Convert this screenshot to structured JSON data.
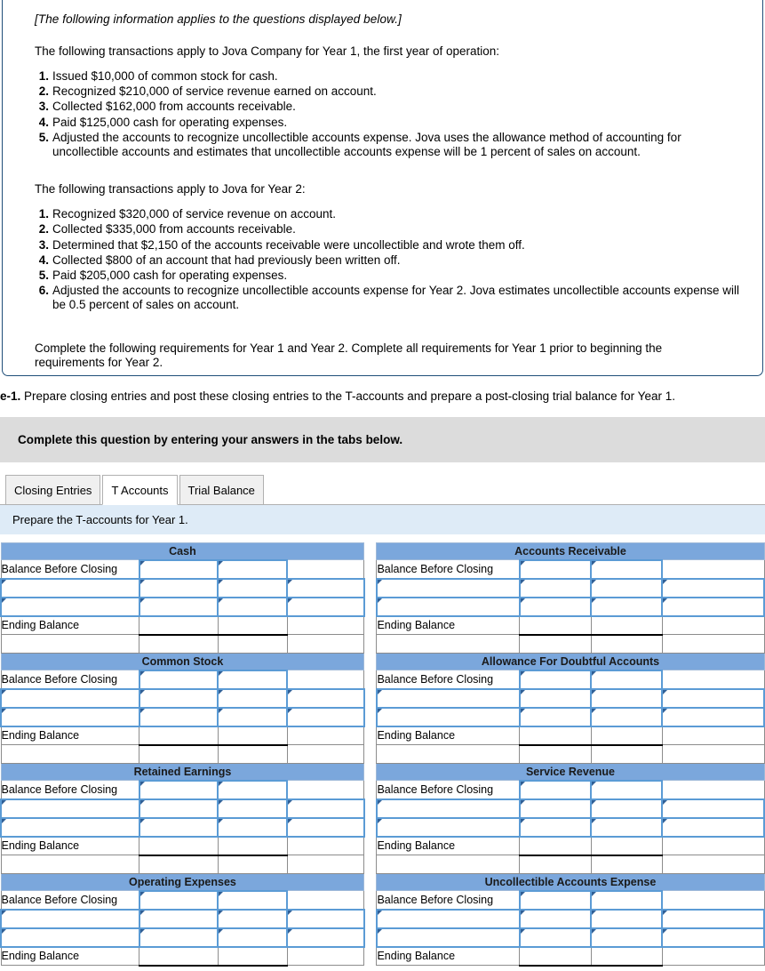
{
  "info_box": {
    "italic_note": "[The following information applies to the questions displayed below.]",
    "year1_intro": "The following transactions apply to Jova Company for Year 1, the first year of operation:",
    "year1_transactions": [
      {
        "num": "1.",
        "text": "Issued $10,000 of common stock for cash."
      },
      {
        "num": "2.",
        "text": "Recognized $210,000 of service revenue earned on account."
      },
      {
        "num": "3.",
        "text": "Collected $162,000 from accounts receivable."
      },
      {
        "num": "4.",
        "text": "Paid $125,000 cash for operating expenses."
      },
      {
        "num": "5.",
        "text": "Adjusted the accounts to recognize uncollectible accounts expense. Jova uses the allowance method of accounting for uncollectible accounts and estimates that uncollectible accounts expense will be 1 percent of sales on account."
      }
    ],
    "year2_intro": "The following transactions apply to Jova for Year 2:",
    "year2_transactions": [
      {
        "num": "1.",
        "text": "Recognized $320,000 of service revenue on account."
      },
      {
        "num": "2.",
        "text": "Collected $335,000 from accounts receivable."
      },
      {
        "num": "3.",
        "text": "Determined that $2,150 of the accounts receivable were uncollectible and wrote them off."
      },
      {
        "num": "4.",
        "text": "Collected $800 of an account that had previously been written off."
      },
      {
        "num": "5.",
        "text": "Paid $205,000 cash for operating expenses."
      },
      {
        "num": "6.",
        "text": "Adjusted the accounts to recognize uncollectible accounts expense for Year 2. Jova estimates uncollectible accounts expense will be 0.5 percent of sales on account."
      }
    ],
    "closing_instruction": "Complete the following requirements for Year 1 and Year 2. Complete all requirements for Year 1 prior to beginning the requirements for Year 2."
  },
  "requirement": {
    "id": "e-1.",
    "text": "Prepare closing entries and post these closing entries to the T-accounts and prepare a post-closing trial balance for Year 1."
  },
  "gray_panel": {
    "text": "Complete this question by entering your answers in the tabs below."
  },
  "tabs": [
    {
      "label": "Closing Entries",
      "active": false
    },
    {
      "label": "T Accounts",
      "active": true
    },
    {
      "label": "Trial Balance",
      "active": false
    }
  ],
  "instruction_strip": {
    "text": "Prepare the T-accounts for Year 1."
  },
  "row_labels": {
    "balance_before_closing": "Balance Before Closing",
    "ending_balance": "Ending Balance"
  },
  "t_accounts": [
    {
      "left": "Cash",
      "right": "Accounts Receivable"
    },
    {
      "left": "Common Stock",
      "right": "Allowance For Doubtful Accounts"
    },
    {
      "left": "Retained Earnings",
      "right": "Service Revenue"
    },
    {
      "left": "Operating Expenses",
      "right": "Uncollectible Accounts Expense"
    }
  ],
  "colors": {
    "account_header_blue": "#7ba7dc",
    "instruction_strip_blue": "#deebf7",
    "gray_panel": "#dcdcdc",
    "input_border_blue": "#5b9bd5",
    "info_border_navy": "#1f4e79"
  }
}
